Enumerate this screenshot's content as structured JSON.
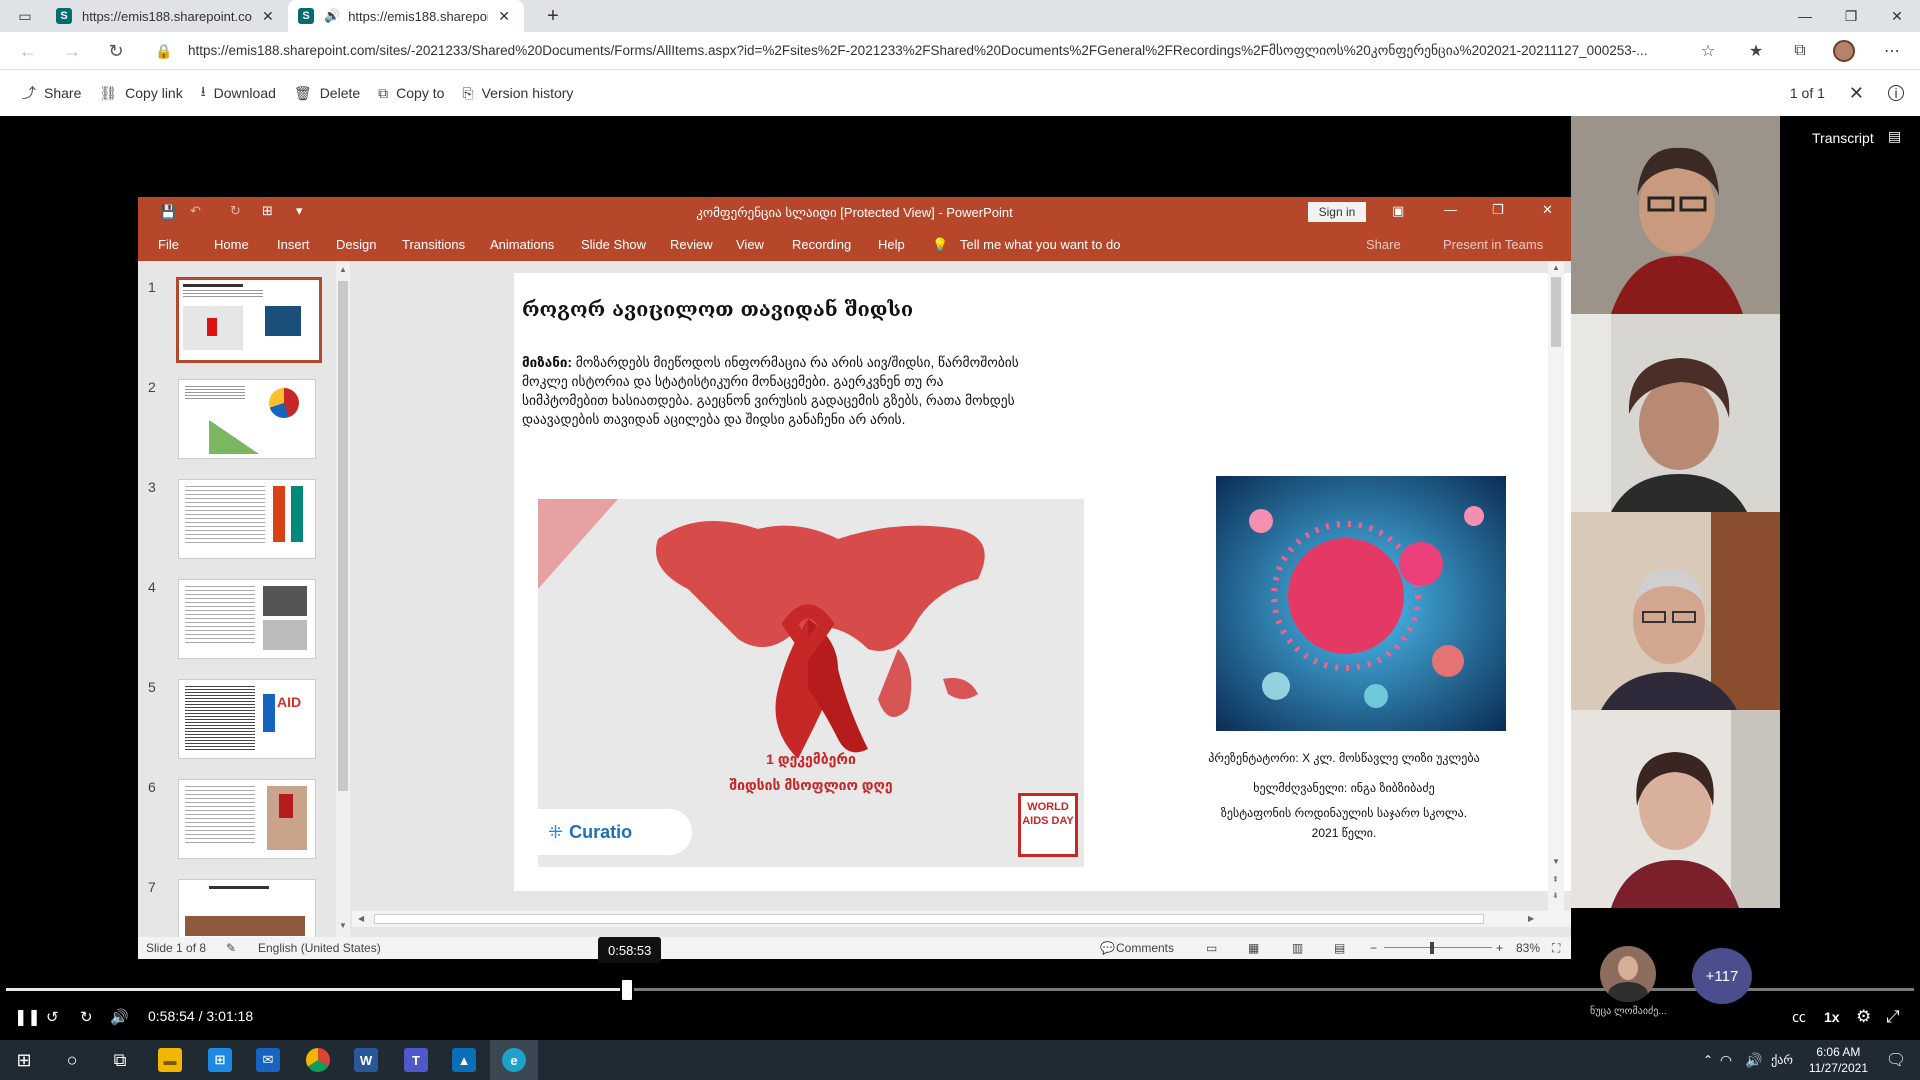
{
  "browser": {
    "tabs": [
      {
        "title": "https://emis188.sharepoint.com/"
      },
      {
        "title": "https://emis188.sharepoint.com/"
      }
    ],
    "url": "https://emis188.sharepoint.com/sites/-2021233/Shared%20Documents/Forms/AllItems.aspx?id=%2Fsites%2F-2021233%2FShared%20Documents%2FGeneral%2FRecordings%2Fმსოფლიოს%20კონფერენცია%202021-20211127_000253-..."
  },
  "commandbar": {
    "share": "Share",
    "copy_link": "Copy link",
    "download": "Download",
    "delete": "Delete",
    "copy_to": "Copy to",
    "version_history": "Version history",
    "page_count": "1 of 1"
  },
  "viewer": {
    "transcript": "Transcript"
  },
  "powerpoint": {
    "window_title": "კომფერენცია სლაიდი [Protected View]  -  PowerPoint",
    "sign_in": "Sign in",
    "ribbon_tabs": [
      "File",
      "Home",
      "Insert",
      "Design",
      "Transitions",
      "Animations",
      "Slide Show",
      "Review",
      "View",
      "Recording",
      "Help"
    ],
    "tell_me": "Tell me what you want to do",
    "share": "Share",
    "present_in_teams": "Present in Teams",
    "thumb_numbers": [
      "1",
      "2",
      "3",
      "4",
      "5",
      "6",
      "7"
    ],
    "slide": {
      "title": "როგორ ავიცილოთ თავიდან შიდსი",
      "goal_label": "მიზანი:",
      "goal_text": " მოზარდებს მიეწოდოს ინფორმაცია რა არის აივ/შიდსი, წარმოშობის მოკლე ისტორია და სტატისტიკური მონაცემები. გაერკვნენ თუ რა სიმპტომებით ხასიათდება. გაეცნონ ვირუსის გადაცემის გზებს, რათა მოხდეს დაავადების თავიდან აცილება და შიდსი განაჩენი არ არის.",
      "ribbon_date": "1 დეკემბერი",
      "ribbon_day": "შიდსის მსოფლიო დღე",
      "curatio": "Curatio",
      "world_aids_day": "WORLD AIDS DAY",
      "credit_1": "პრეზენტატორი: X  კლ. მოსწავლე ლიზი უკლება",
      "credit_2": "ხელმძღვანელი: ინგა ზიბზიბაძე",
      "credit_3": "ზესტაფონის როდინაულის საჯარო სკოლა.",
      "credit_4": "2021 წელი."
    },
    "status": {
      "slide_of": "Slide 1 of 8",
      "language": "English (United States)",
      "comments": "Comments",
      "zoom": "83%"
    }
  },
  "player": {
    "tooltip": "0:58:53",
    "current": "0:58:54",
    "separator": "/",
    "total": "3:01:18",
    "progress": 0.3255,
    "speed": "1x",
    "more_participants": "+117",
    "participant_name": "ნუცა ლომაიძე..."
  },
  "taskbar": {
    "lang": "ქარ",
    "time": "6:06 AM",
    "date": "11/27/2021",
    "notifications": "1"
  }
}
